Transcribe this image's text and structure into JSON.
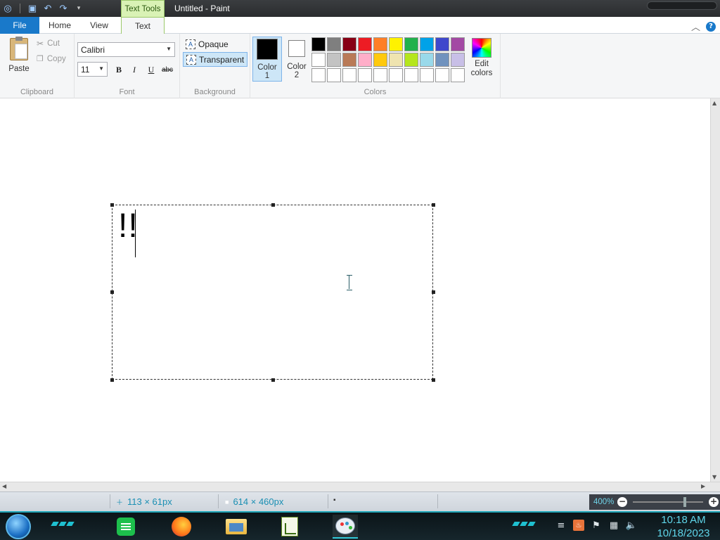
{
  "titlebar": {
    "contextual_tab": "Text Tools",
    "window_title": "Untitled - Paint"
  },
  "tabs": {
    "file": "File",
    "home": "Home",
    "view": "View",
    "text": "Text"
  },
  "clipboard": {
    "paste": "Paste",
    "cut": "Cut",
    "copy": "Copy",
    "group": "Clipboard"
  },
  "font": {
    "family": "Calibri",
    "size": "11",
    "bold": "B",
    "italic": "I",
    "underline": "U",
    "strike": "abc",
    "group": "Font"
  },
  "background": {
    "opaque": "Opaque",
    "transparent": "Transparent",
    "group": "Background"
  },
  "colors": {
    "color1": "Color 1",
    "color2": "Color 2",
    "color1_value": "#000000",
    "color2_value": "#ffffff",
    "edit": "Edit colors",
    "group": "Colors",
    "palette": [
      "#000000",
      "#7f7f7f",
      "#880015",
      "#ed1c24",
      "#ff7f27",
      "#fff200",
      "#22b14c",
      "#00a2e8",
      "#3f48cc",
      "#a349a4",
      "#ffffff",
      "#c3c3c3",
      "#b97a57",
      "#ffaec9",
      "#ffc90e",
      "#efe4b0",
      "#b5e61d",
      "#99d9ea",
      "#7092be",
      "#c8bfe7",
      "#ffffff",
      "#ffffff",
      "#ffffff",
      "#ffffff",
      "#ffffff",
      "#ffffff",
      "#ffffff",
      "#ffffff",
      "#ffffff",
      "#ffffff"
    ]
  },
  "canvas": {
    "typed_text": "!!"
  },
  "status": {
    "cursor_pos": "113 × 61px",
    "selection_size": "614 × 460px",
    "zoom": "400%",
    "zoom_out": "−",
    "zoom_in": "+"
  },
  "clock": {
    "time": "10:18 AM",
    "date": "10/18/2023"
  }
}
